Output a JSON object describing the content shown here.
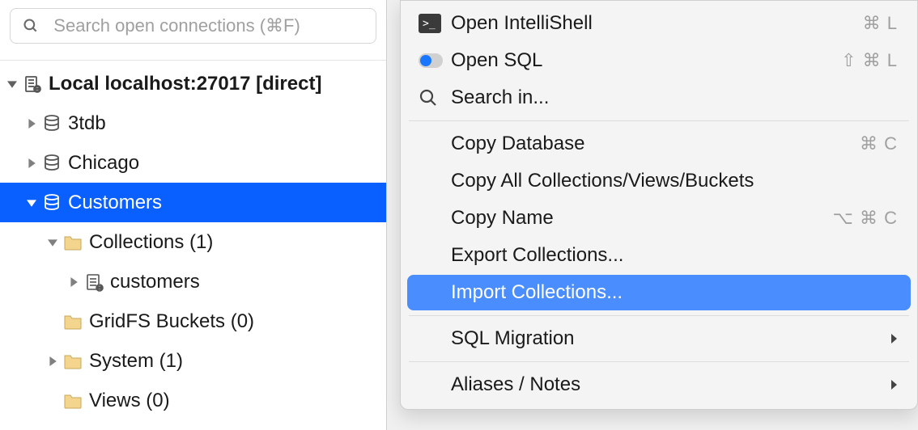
{
  "search": {
    "placeholder": "Search open connections (⌘F)"
  },
  "tree": {
    "root": "Local localhost:27017 [direct]",
    "db_3tdb": "3tdb",
    "db_chicago": "Chicago",
    "db_customers": "Customers",
    "collections": "Collections (1)",
    "customers_coll": "customers",
    "gridfs": "GridFS Buckets (0)",
    "system": "System (1)",
    "views": "Views (0)"
  },
  "menu": {
    "open_intellishell": "Open IntelliShell",
    "open_sql": "Open SQL",
    "search_in": "Search in...",
    "copy_database": "Copy Database",
    "copy_all": "Copy All Collections/Views/Buckets",
    "copy_name": "Copy Name",
    "export_collections": "Export Collections...",
    "import_collections": "Import Collections...",
    "sql_migration": "SQL Migration",
    "aliases_notes": "Aliases / Notes",
    "shortcut_cmd_l": "⌘ L",
    "shortcut_shift_cmd_l": "⇧ ⌘ L",
    "shortcut_cmd_c": "⌘ C",
    "shortcut_opt_cmd_c": "⌥ ⌘ C"
  }
}
